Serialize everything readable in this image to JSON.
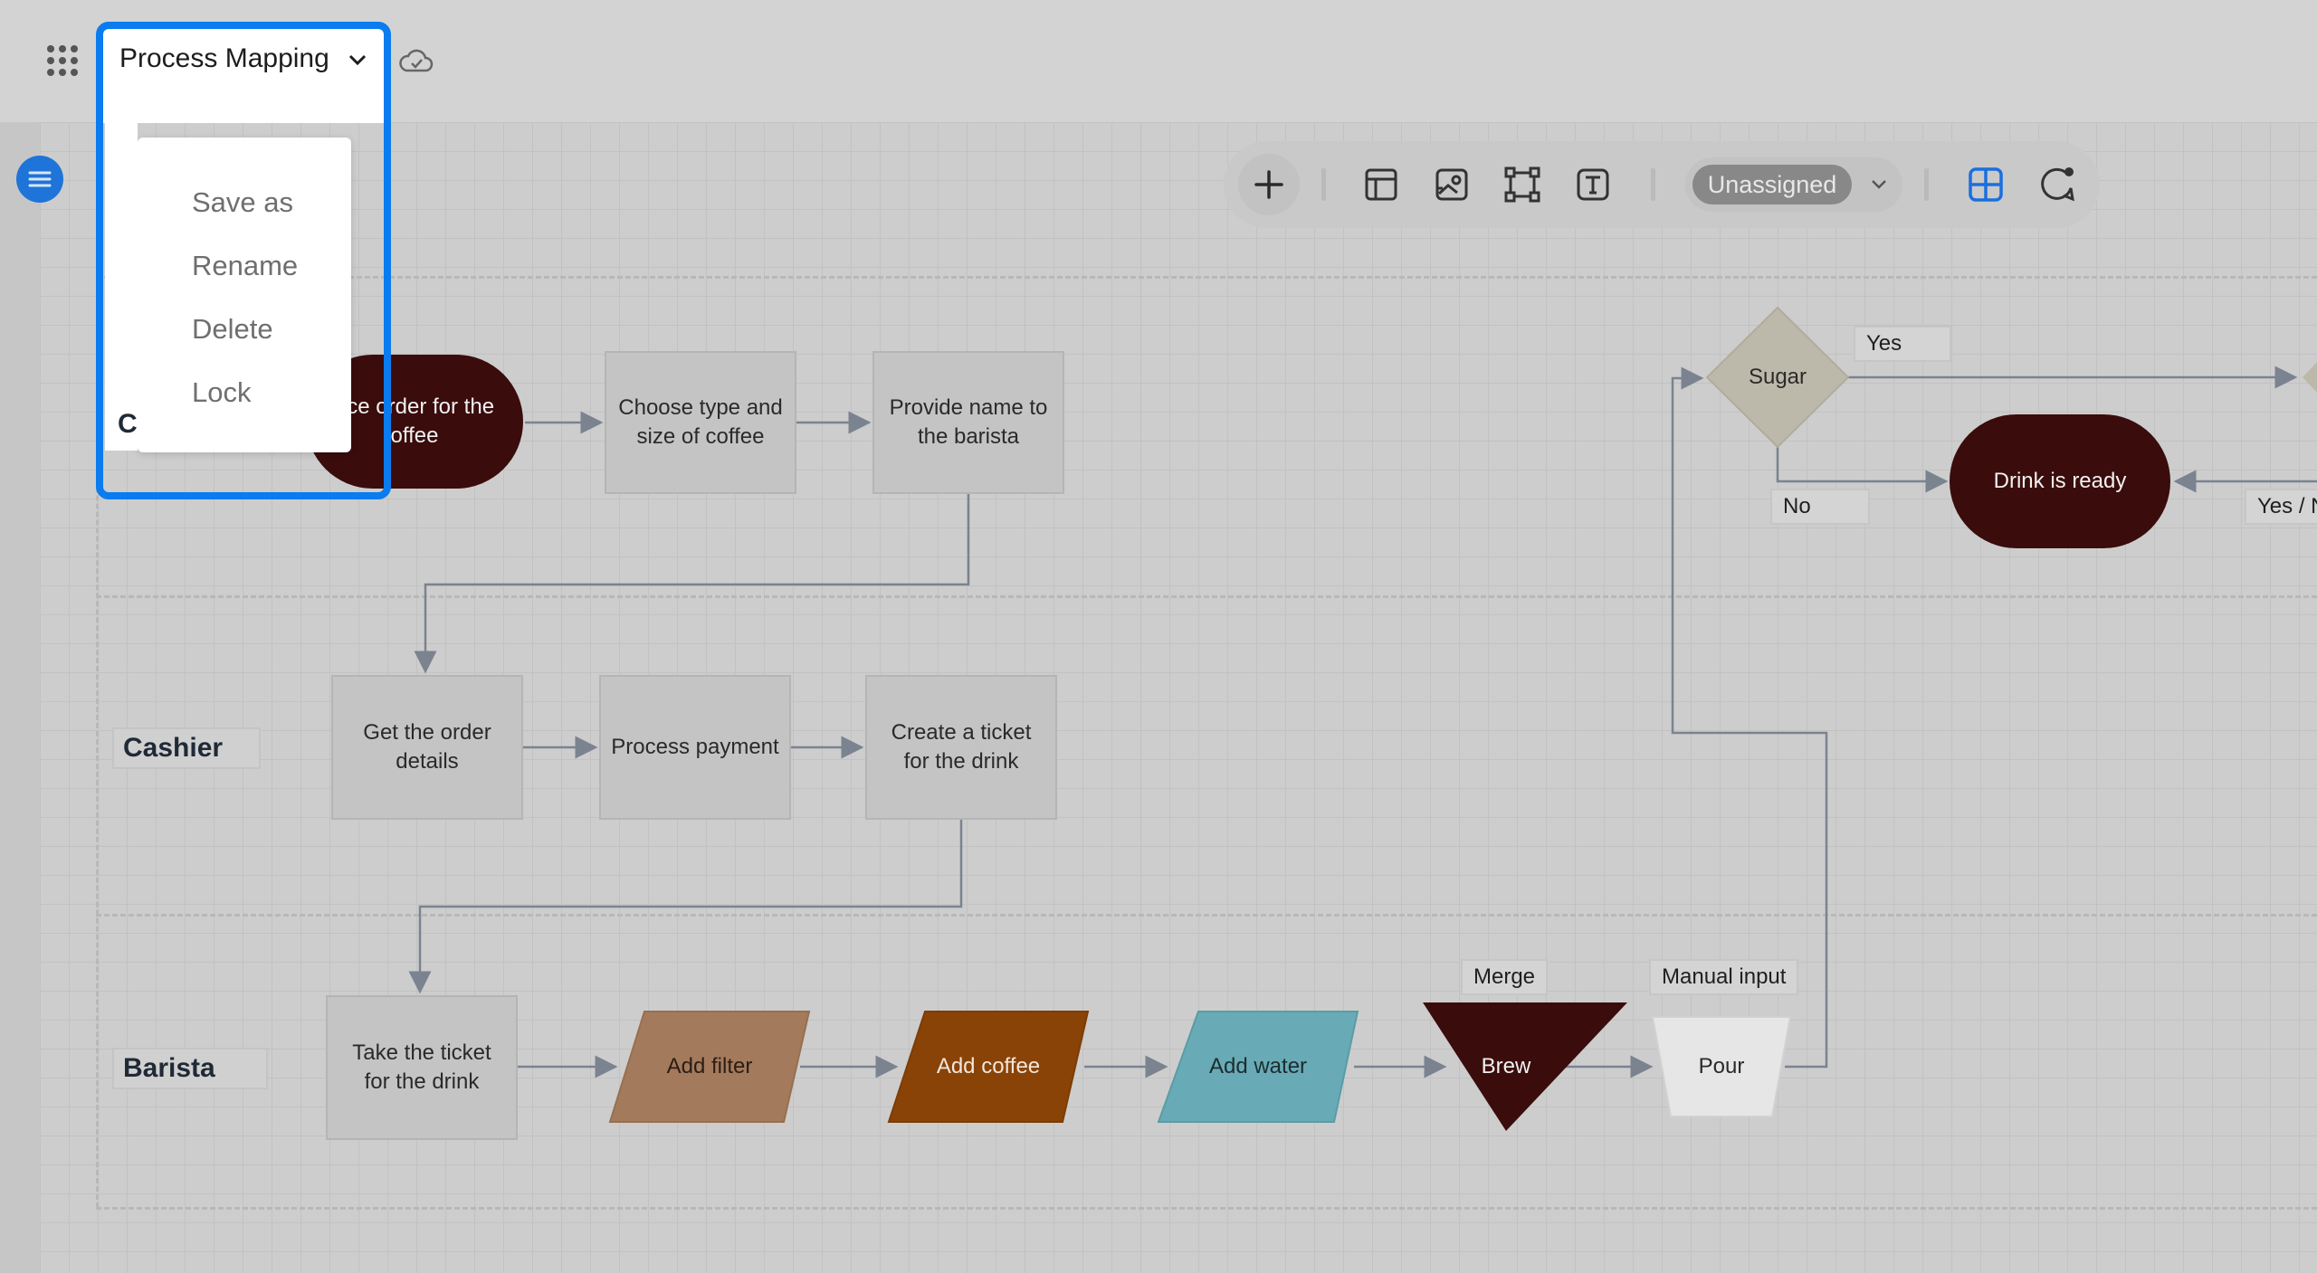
{
  "header": {
    "doc_title": "Process Mapping",
    "icons": [
      "apps-grid-icon",
      "chevron-down-icon",
      "cloud-sync-icon"
    ]
  },
  "menu": {
    "items": [
      {
        "label": "Save as"
      },
      {
        "label": "Rename"
      },
      {
        "label": "Delete"
      },
      {
        "label": "Lock"
      }
    ]
  },
  "toolbar": {
    "icons": [
      "plus-icon",
      "table-layout-icon",
      "image-icon",
      "frame-icon",
      "text-icon",
      "grid-icon",
      "comment-icon"
    ],
    "assignee": "Unassigned"
  },
  "lanes": {
    "customer_label": "C",
    "cashier_label": "Cashier",
    "barista_label": "Barista"
  },
  "nodes": {
    "place_order": "ace order for the\noffee",
    "choose_type": "Choose type and\nsize of coffee",
    "provide_name": "Provide name to\nthe barista",
    "get_order": "Get the order\ndetails",
    "process_payment": "Process payment",
    "create_ticket": "Create a ticket\nfor the drink",
    "take_ticket": "Take the ticket\nfor the drink",
    "add_filter": "Add filter",
    "add_coffee": "Add coffee",
    "add_water": "Add water",
    "brew": "Brew",
    "pour": "Pour",
    "sugar": "Sugar",
    "drink_ready": "Drink is ready"
  },
  "labels": {
    "yes": "Yes",
    "no": "No",
    "yes_no": "Yes / N",
    "merge": "Merge",
    "manual_input": "Manual input"
  },
  "colors": {
    "accent": "#0a7cf0",
    "terminal": "#3a0c0c",
    "filter": "#a47a5c",
    "coffee": "#8a4306",
    "water": "#68abb6"
  }
}
